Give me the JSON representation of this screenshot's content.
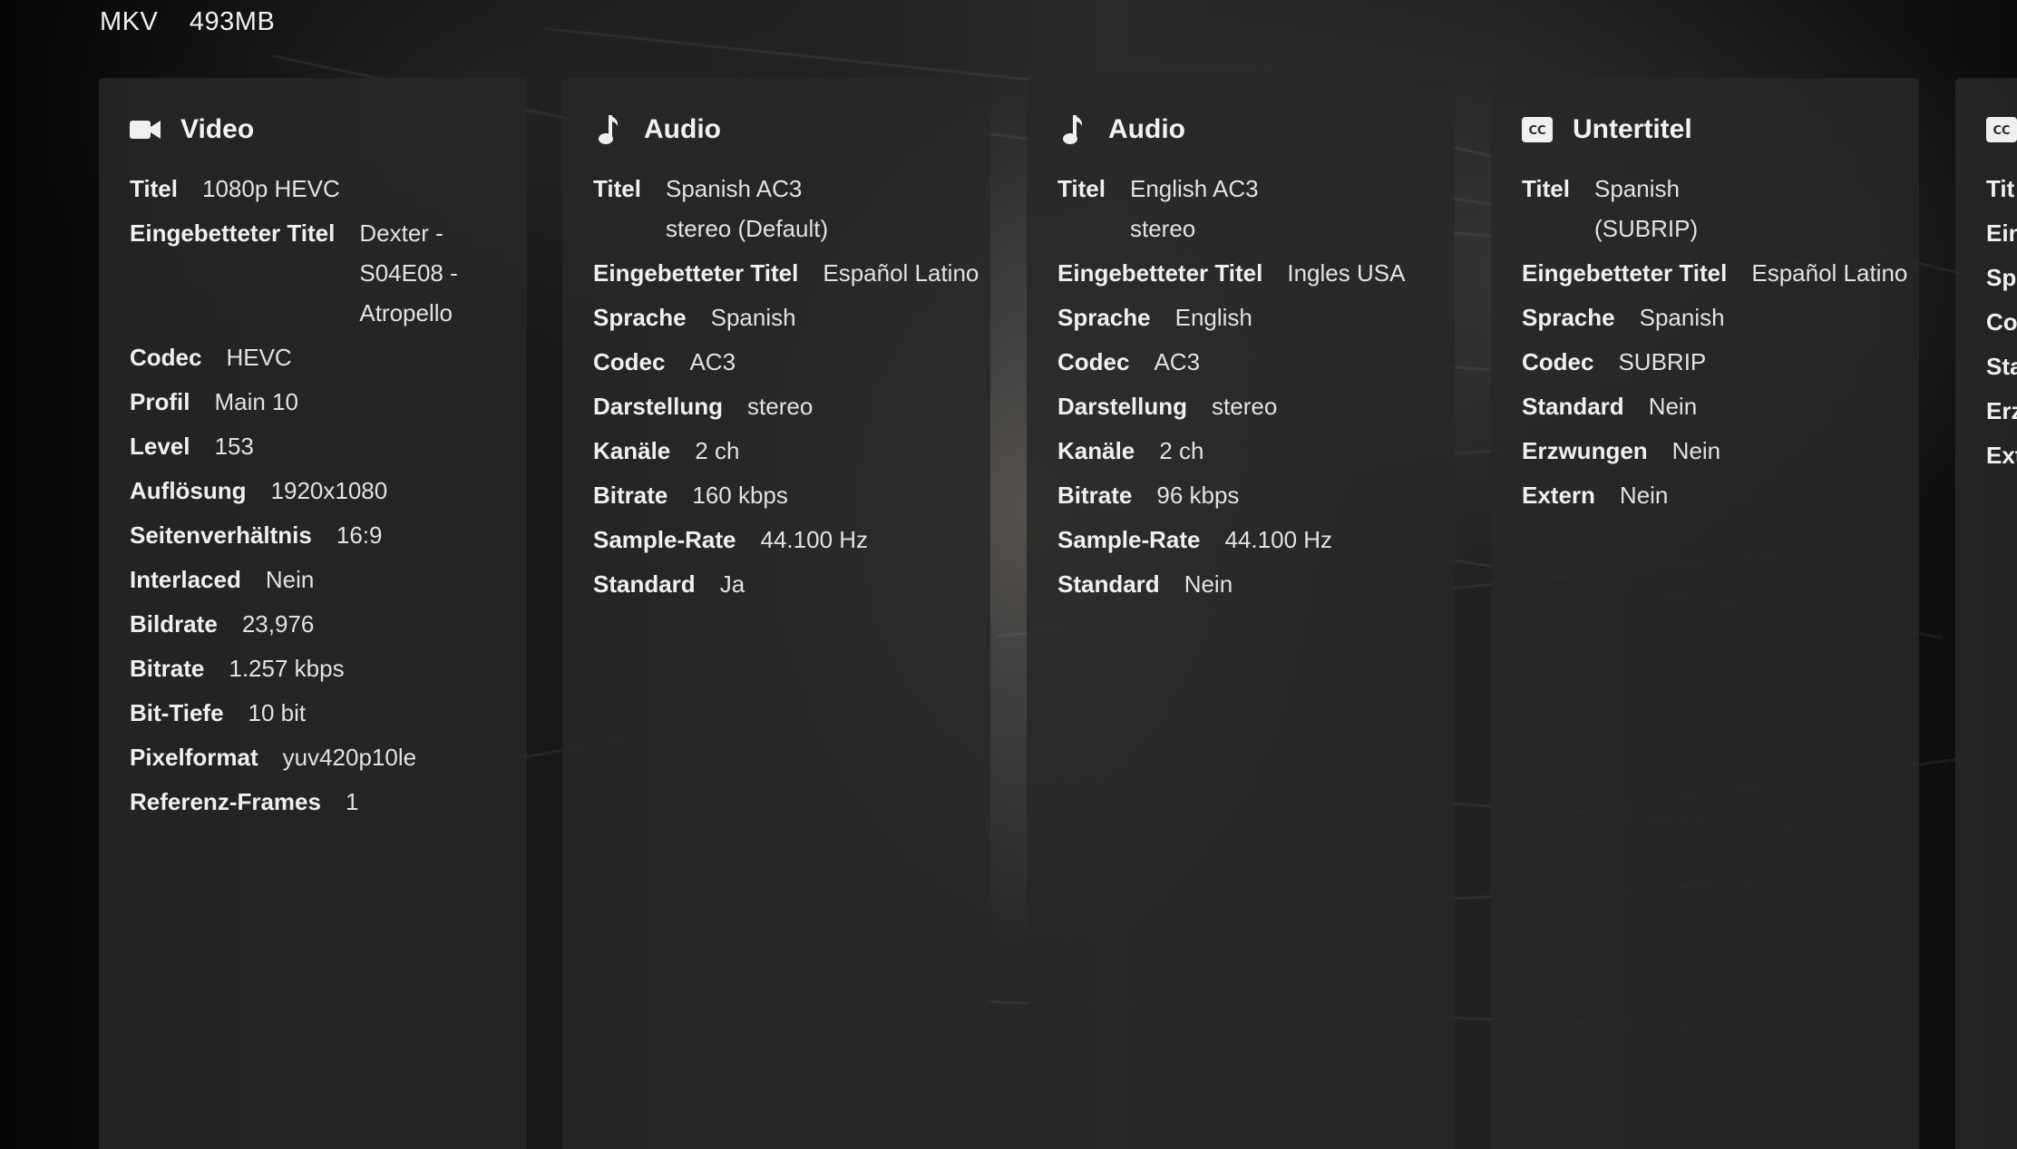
{
  "file": {
    "container": "MKV",
    "size": "493MB"
  },
  "streams": [
    {
      "title": "Video",
      "icon": "video-camera-icon",
      "rows": [
        {
          "k": "Titel",
          "v": "1080p HEVC"
        },
        {
          "k": "Eingebetteter Titel",
          "v": "Dexter - S04E08 - Atropello"
        },
        {
          "k": "Codec",
          "v": "HEVC"
        },
        {
          "k": "Profil",
          "v": "Main 10"
        },
        {
          "k": "Level",
          "v": "153"
        },
        {
          "k": "Auflösung",
          "v": "1920x1080"
        },
        {
          "k": "Seitenverhältnis",
          "v": "16:9"
        },
        {
          "k": "Interlaced",
          "v": "Nein"
        },
        {
          "k": "Bildrate",
          "v": "23,976"
        },
        {
          "k": "Bitrate",
          "v": "1.257 kbps"
        },
        {
          "k": "Bit-Tiefe",
          "v": "10 bit"
        },
        {
          "k": "Pixelformat",
          "v": "yuv420p10le"
        },
        {
          "k": "Referenz-Frames",
          "v": "1"
        }
      ]
    },
    {
      "title": "Audio",
      "icon": "music-note-icon",
      "rows": [
        {
          "k": "Titel",
          "v": "Spanish AC3 stereo (Default)"
        },
        {
          "k": "Eingebetteter Titel",
          "v": "Español Latino"
        },
        {
          "k": "Sprache",
          "v": "Spanish"
        },
        {
          "k": "Codec",
          "v": "AC3"
        },
        {
          "k": "Darstellung",
          "v": "stereo"
        },
        {
          "k": "Kanäle",
          "v": "2 ch"
        },
        {
          "k": "Bitrate",
          "v": "160 kbps"
        },
        {
          "k": "Sample-Rate",
          "v": "44.100 Hz"
        },
        {
          "k": "Standard",
          "v": "Ja"
        }
      ]
    },
    {
      "title": "Audio",
      "icon": "music-note-icon",
      "rows": [
        {
          "k": "Titel",
          "v": "English AC3 stereo"
        },
        {
          "k": "Eingebetteter Titel",
          "v": "Ingles USA"
        },
        {
          "k": "Sprache",
          "v": "English"
        },
        {
          "k": "Codec",
          "v": "AC3"
        },
        {
          "k": "Darstellung",
          "v": "stereo"
        },
        {
          "k": "Kanäle",
          "v": "2 ch"
        },
        {
          "k": "Bitrate",
          "v": "96 kbps"
        },
        {
          "k": "Sample-Rate",
          "v": "44.100 Hz"
        },
        {
          "k": "Standard",
          "v": "Nein"
        }
      ]
    },
    {
      "title": "Untertitel",
      "icon": "closed-caption-icon",
      "rows": [
        {
          "k": "Titel",
          "v": "Spanish (SUBRIP)"
        },
        {
          "k": "Eingebetteter Titel",
          "v": "Español Latino"
        },
        {
          "k": "Sprache",
          "v": "Spanish"
        },
        {
          "k": "Codec",
          "v": "SUBRIP"
        },
        {
          "k": "Standard",
          "v": "Nein"
        },
        {
          "k": "Erzwungen",
          "v": "Nein"
        },
        {
          "k": "Extern",
          "v": "Nein"
        }
      ]
    },
    {
      "title": "",
      "icon": "closed-caption-icon",
      "rows": [
        {
          "k": "Tit",
          "v": ""
        },
        {
          "k": "Ein",
          "v": ""
        },
        {
          "k": "Sp",
          "v": ""
        },
        {
          "k": "Co",
          "v": ""
        },
        {
          "k": "Sta",
          "v": ""
        },
        {
          "k": "Erz",
          "v": ""
        },
        {
          "k": "Ext",
          "v": ""
        }
      ]
    }
  ]
}
